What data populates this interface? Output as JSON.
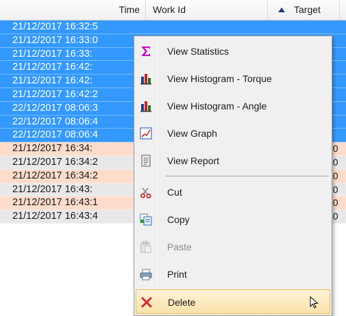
{
  "grid": {
    "columns": {
      "time": "Time",
      "work_id": "Work Id",
      "target": "Target"
    },
    "rows": [
      {
        "time": "21/12/2017 16:32:5",
        "target": "",
        "state": "selected"
      },
      {
        "time": "21/12/2017 16:33:0",
        "target": "",
        "state": "selected"
      },
      {
        "time": "21/12/2017 16:33:",
        "target": "",
        "state": "selected"
      },
      {
        "time": "21/12/2017 16:42:",
        "target": "",
        "state": "selected"
      },
      {
        "time": "21/12/2017 16:42:",
        "target": "",
        "state": "selected"
      },
      {
        "time": "21/12/2017 16:42:2",
        "target": "",
        "state": "selected"
      },
      {
        "time": "22/12/2017 08:06:3",
        "target": "",
        "state": "selected"
      },
      {
        "time": "22/12/2017 08:06:4",
        "target": "",
        "state": "selected"
      },
      {
        "time": "22/12/2017 08:06:4",
        "target": "",
        "state": "selected"
      },
      {
        "time": "21/12/2017 16:34:",
        "target": "10",
        "state": "pink"
      },
      {
        "time": "21/12/2017 16:34:2",
        "target": "10",
        "state": "grey"
      },
      {
        "time": "21/12/2017 16:34:2",
        "target": "10",
        "state": "pink"
      },
      {
        "time": "21/12/2017 16:43:",
        "target": "10",
        "state": "grey"
      },
      {
        "time": "21/12/2017 16:43:1",
        "target": "10",
        "state": "pink"
      },
      {
        "time": "21/12/2017 16:43:4",
        "target": "10",
        "state": "grey"
      }
    ]
  },
  "menu": {
    "items": [
      {
        "label": "View Statistics",
        "icon": "sigma-icon"
      },
      {
        "label": "View Histogram - Torque",
        "icon": "histogram-icon"
      },
      {
        "label": "View Histogram - Angle",
        "icon": "histogram-icon"
      },
      {
        "label": "View Graph",
        "icon": "graph-icon"
      },
      {
        "label": "View Report",
        "icon": "report-icon"
      },
      {
        "label": "Cut",
        "icon": "scissors-icon"
      },
      {
        "label": "Copy",
        "icon": "copy-icon"
      },
      {
        "label": "Paste",
        "icon": "paste-icon",
        "disabled": true
      },
      {
        "label": "Print",
        "icon": "printer-icon"
      },
      {
        "label": "Delete",
        "icon": "delete-icon",
        "highlighted": true
      }
    ]
  },
  "colors": {
    "selection": "#3399ff",
    "row_pink": "#fddccc",
    "row_grey": "#e8e8e8",
    "menu_highlight": "#fbe2a9",
    "delete_red": "#d9262c",
    "sigma_magenta": "#c800c8"
  }
}
